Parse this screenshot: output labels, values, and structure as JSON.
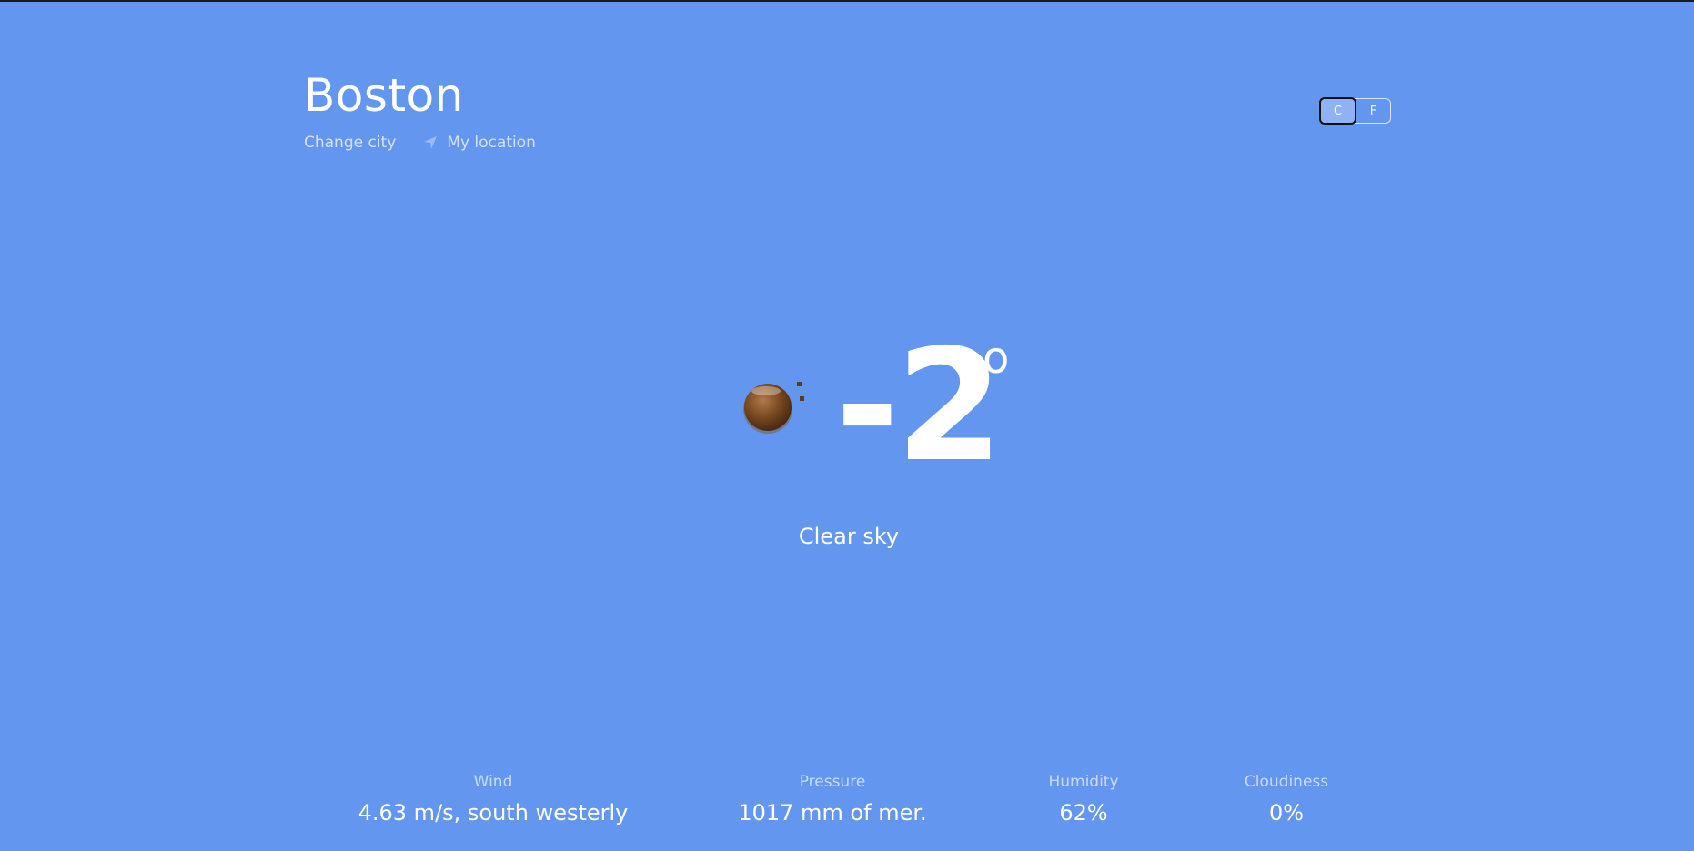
{
  "header": {
    "city": "Boston",
    "change_city": "Change city",
    "my_location": "My location"
  },
  "units": {
    "celsius": "C",
    "fahrenheit": "F",
    "selected": "C"
  },
  "current": {
    "temperature": "-2",
    "degree_symbol": "o",
    "description": "Clear sky",
    "icon": "moon-icon"
  },
  "stats": [
    {
      "label": "Wind",
      "value": "4.63 m/s, south westerly"
    },
    {
      "label": "Pressure",
      "value": "1017 mm of mer."
    },
    {
      "label": "Humidity",
      "value": "62%"
    },
    {
      "label": "Cloudiness",
      "value": "0%"
    }
  ],
  "colors": {
    "background": "#6396ee",
    "text": "#ffffff"
  }
}
